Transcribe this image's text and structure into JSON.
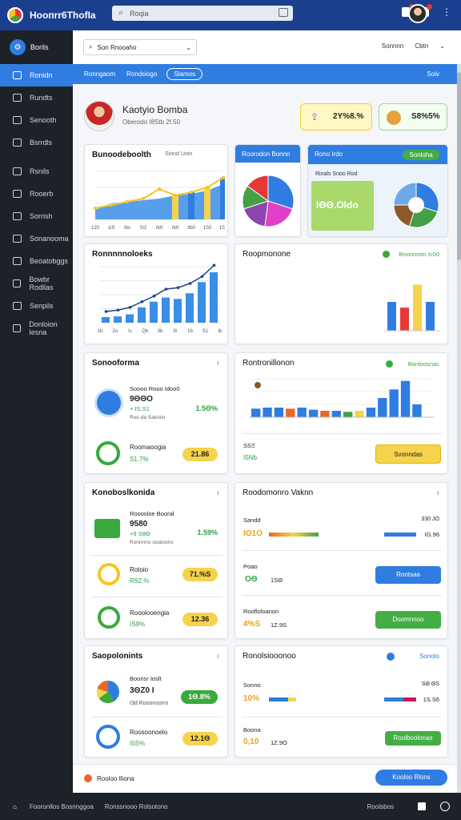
{
  "topbar": {
    "app_title": "Ноoпrr6ThofIa",
    "search_placeholder": "Roqia"
  },
  "sidebar": {
    "header": "Borils",
    "items": [
      {
        "label": "Ronidn",
        "icon": "home-icon"
      },
      {
        "label": "Rundts",
        "icon": "link-icon"
      },
      {
        "label": "Senooth",
        "icon": "box-icon"
      },
      {
        "label": "Bsrrdls",
        "icon": "grid-icon"
      },
      {
        "label": "Rsnils",
        "icon": "cart-icon"
      },
      {
        "label": "Rooerb",
        "icon": "tool-icon"
      },
      {
        "label": "Sorrish",
        "icon": "calendar-icon"
      },
      {
        "label": "Sonanooma",
        "icon": "mail-icon"
      },
      {
        "label": "Beoatobggs",
        "icon": "gear-icon"
      },
      {
        "label": "Bowbr Rodllas",
        "icon": "user-icon"
      },
      {
        "label": "Senpils",
        "icon": "pen-icon"
      },
      {
        "label": "Donloion Iesna",
        "icon": "doc-icon"
      }
    ]
  },
  "filterbar": {
    "select_value": "Son Rnooaho",
    "right_a": "Sonnnn",
    "right_b": "Cbtn"
  },
  "bluebar": {
    "a": "Ronngaom",
    "b": "Rondsiogo",
    "pill": "Slamos",
    "right": "Soiv"
  },
  "profile": {
    "name": "Kaotyio Bomba",
    "sub": "Oberodo I8Stb 2f.50",
    "kpi1": "2Y%8.%",
    "kpi2": "S8%5%"
  },
  "card_revenue": {
    "title": "Bunoodeboolth",
    "legend": "Sinnd Uoin"
  },
  "card_pie1": {
    "title": "Roorodon Bonnn"
  },
  "card_pie2": {
    "title": "Rono Irdo",
    "btn": "Sonloha",
    "mini": "Rinals Snoo Rod",
    "value": "ΙΘΘ.Oldo"
  },
  "card_line2": {
    "title": "Ronnnnnoloeks"
  },
  "card_bar2": {
    "title": "Roopmonone",
    "status": "Bnonnnon Ic00"
  },
  "card_sensor": {
    "title": "Sonooforma",
    "mini": "Soooo Rooo Idoo0",
    "value": "9ΘΘO",
    "delta": "+ IS.S1",
    "sub": "Roo da Saloolo",
    "pct": "1.5Θ%",
    "row2_label": "Roomaoogia",
    "row2_value": "S1.7%",
    "row2_pill": "21.86"
  },
  "card_flow": {
    "title": "Rontronillonon",
    "status": "Banloosnac",
    "l1": "SSΞ",
    "l2": "I5Nb",
    "btn": "Svonndas"
  },
  "card_k": {
    "title": "Konoboslkonida",
    "mini": "Rooosloe Booral",
    "value": "9580",
    "delta": "+9 S8Θ",
    "sub": "Ronnnno ooalosiro",
    "pct": "1.59%",
    "r2_label": "Rotoio",
    "r2_value": "R9Z.%",
    "r2_pill": "71.%S",
    "r3_label": "Rooolooengia",
    "r3_value": "IS9%",
    "r3_pill": "12.36"
  },
  "card_mon": {
    "title": "Roodomonro Vaknn",
    "r1_label": "Sandd",
    "r1_value": "IO1O",
    "r1_right": "330 JO",
    "r1_right2": "IG.96",
    "r2_label": "Poao",
    "r2_value": "OΘ",
    "r2_small": "1SΘ",
    "r2_btn": "Rontsaa",
    "r3_label": "Roofloloanon",
    "r3_value": "4%S",
    "r3_small": "1Z.9S",
    "r3_btn": "Doomnnoo"
  },
  "card_s": {
    "title": "Saopolonints",
    "mini": "Boonsr Ioslt",
    "value": "3ΘZ0 I",
    "sub": "I3d Rooonsorro",
    "pill": "1Θ.8%",
    "r2_label": "Roosoonoelo",
    "r2_value": "I5S%",
    "r2_pill": "12.1Θ"
  },
  "card_r": {
    "title": "Ronolsiooonoo",
    "right_link": "Sonolo",
    "r1_label": "Sonno",
    "r1_value": "10%",
    "r1_right": "SΘ ΘS",
    "r1_right2": "1S.S6",
    "r2_label": "Boona",
    "r2_value": "0,10",
    "r2_small": "1Z.9O",
    "r2_btn": "Roolboolonas"
  },
  "footer": {
    "label": "Rooloo Iliona",
    "btn": "Kooloo Rlons"
  },
  "bottombar": {
    "a": "Fooronllos Bosnnggoa",
    "b": "Ronssnooo Rolsotono",
    "c": "Roolsbos"
  },
  "chart_data": [
    {
      "type": "area",
      "title": "",
      "x": [
        "120",
        "1iS",
        "Ibs",
        "Si2",
        "Ib0",
        "Ib0",
        "3b0",
        "1S0",
        "1S0"
      ],
      "series": [
        {
          "values": [
            12,
            20,
            22,
            24,
            26,
            30,
            32,
            36,
            44
          ]
        },
        {
          "values": [
            14,
            18,
            22,
            26,
            38,
            30,
            34,
            40,
            52
          ]
        }
      ]
    },
    {
      "type": "bar",
      "title": "",
      "x": [
        "1b",
        "2o",
        "Is",
        "Qb",
        "3b",
        "Sl",
        "1b",
        "S1",
        "Ib"
      ],
      "values": [
        8,
        9,
        12,
        22,
        30,
        36,
        34,
        42,
        58,
        72
      ],
      "series": [
        {
          "values": [
            8,
            10,
            14,
            22,
            30,
            40,
            42,
            48,
            58,
            74
          ]
        }
      ]
    },
    {
      "type": "pie",
      "slices": [
        {
          "label": "a",
          "value": 30,
          "color": "#2f7de1"
        },
        {
          "label": "b",
          "value": 22,
          "color": "#e040c8"
        },
        {
          "label": "c",
          "value": 18,
          "color": "#8e44ad"
        },
        {
          "label": "d",
          "value": 15,
          "color": "#43a047"
        },
        {
          "label": "e",
          "value": 15,
          "color": "#e53935"
        }
      ]
    },
    {
      "type": "bar",
      "title": "",
      "values": [
        30,
        24,
        48,
        30
      ],
      "colors": [
        "#2f7de1",
        "#e53935",
        "#f6d34c",
        "#2f7de1"
      ]
    },
    {
      "type": "bar",
      "title": "",
      "values": [
        8,
        9,
        9,
        8,
        9,
        7,
        6,
        6,
        5,
        6,
        9,
        18,
        26,
        34,
        12,
        0
      ],
      "colors": [
        "#2f7de1",
        "#2f7de1",
        "#2f7de1",
        "#e8682a",
        "#2f7de1",
        "#2f7de1",
        "#e8682a",
        "#2f7de1",
        "#43a047",
        "#f6d34c",
        "#2f7de1",
        "#2f7de1",
        "#2f7de1",
        "#2f7de1",
        "#2f7de1",
        "#2f7de1"
      ]
    }
  ],
  "colors": {
    "primary": "#2f7de1",
    "dark": "#1d2128",
    "accent_yellow": "#f6d34c",
    "accent_green": "#39a93d"
  }
}
